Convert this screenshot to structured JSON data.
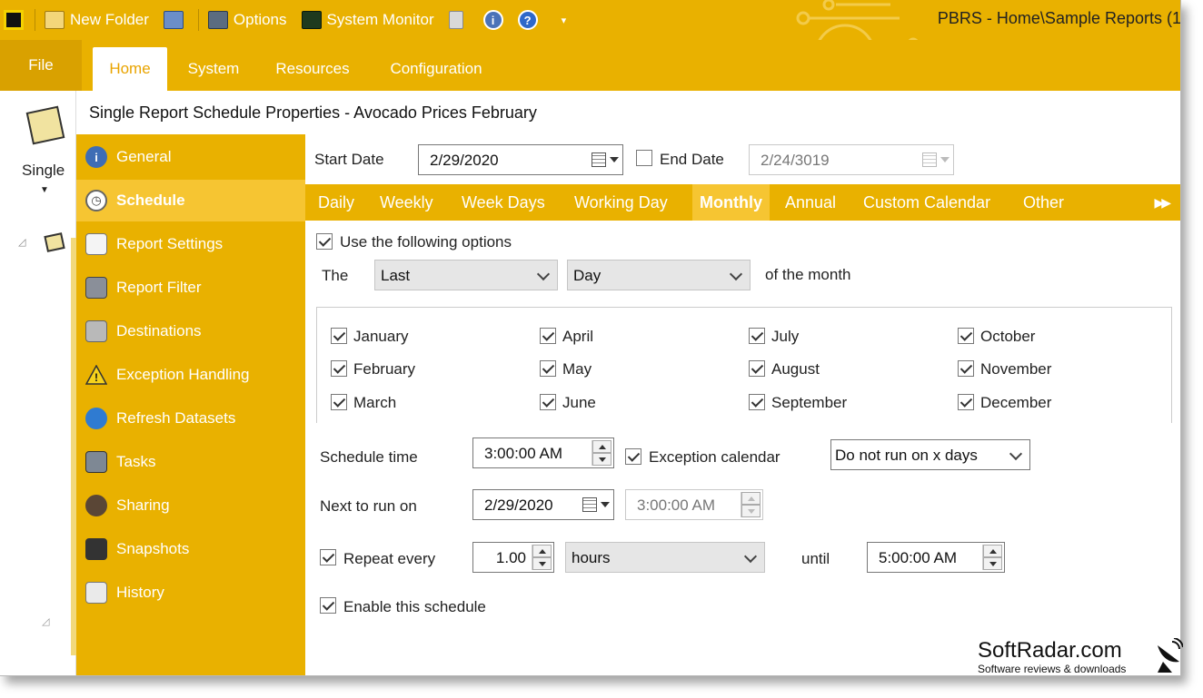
{
  "window": {
    "title": "PBRS - Home\\Sample Reports (1"
  },
  "quick_access": {
    "new_folder": "New Folder",
    "options": "Options",
    "system_monitor": "System Monitor",
    "info_icon_glyph": "i",
    "help_icon_glyph": "?"
  },
  "ribbon": {
    "tabs": [
      "File",
      "Home",
      "System",
      "Resources",
      "Configuration"
    ],
    "active_tab": "Home",
    "single_button": "Single"
  },
  "dialog": {
    "title": "Single Report Schedule Properties - Avocado Prices February",
    "nav": [
      {
        "label": "General",
        "icon": "info-icon"
      },
      {
        "label": "Schedule",
        "icon": "clock-icon"
      },
      {
        "label": "Report Settings",
        "icon": "report-settings-icon"
      },
      {
        "label": "Report Filter",
        "icon": "filter-icon"
      },
      {
        "label": "Destinations",
        "icon": "destinations-icon"
      },
      {
        "label": "Exception Handling",
        "icon": "warning-icon"
      },
      {
        "label": "Refresh Datasets",
        "icon": "refresh-icon"
      },
      {
        "label": "Tasks",
        "icon": "tasks-icon"
      },
      {
        "label": "Sharing",
        "icon": "sharing-icon"
      },
      {
        "label": "Snapshots",
        "icon": "camera-icon"
      },
      {
        "label": "History",
        "icon": "history-icon"
      }
    ],
    "active_nav": "Schedule"
  },
  "schedule": {
    "start_date_label": "Start Date",
    "start_date": "2/29/2020",
    "end_date_label": "End Date",
    "end_date_checked": false,
    "end_date": "2/24/3019",
    "frequency_tabs": [
      "Daily",
      "Weekly",
      "Week Days",
      "Working Day",
      "Monthly",
      "Annual",
      "Custom Calendar",
      "Other"
    ],
    "active_frequency": "Monthly",
    "use_options_label": "Use the following options",
    "use_options_checked": true,
    "the_label": "The",
    "ordinal_value": "Last",
    "day_value": "Day",
    "of_month_label": "of  the  month",
    "months": [
      {
        "label": "January",
        "checked": true
      },
      {
        "label": "February",
        "checked": true
      },
      {
        "label": "March",
        "checked": true
      },
      {
        "label": "April",
        "checked": true
      },
      {
        "label": "May",
        "checked": true
      },
      {
        "label": "June",
        "checked": true
      },
      {
        "label": "July",
        "checked": true
      },
      {
        "label": "August",
        "checked": true
      },
      {
        "label": "September",
        "checked": true
      },
      {
        "label": "October",
        "checked": true
      },
      {
        "label": "November",
        "checked": true
      },
      {
        "label": "December",
        "checked": true
      }
    ],
    "schedule_time_label": "Schedule time",
    "schedule_time": "3:00:00 AM",
    "exception_calendar_label": "Exception calendar",
    "exception_calendar_checked": true,
    "exception_option": "Do not run on x days",
    "next_run_label": "Next to run on",
    "next_run_date": "2/29/2020",
    "next_run_time": "3:00:00 AM",
    "repeat_label": "Repeat every",
    "repeat_checked": true,
    "repeat_value": "1.00",
    "repeat_unit": "hours",
    "until_label": "until",
    "until_time": "5:00:00 AM",
    "enable_label": "Enable this schedule",
    "enable_checked": true
  },
  "watermark": {
    "main": "SoftRadar.com",
    "sub": "Software reviews & downloads"
  },
  "colors": {
    "brand": "#e9b100",
    "brand_active": "#f6c532"
  }
}
